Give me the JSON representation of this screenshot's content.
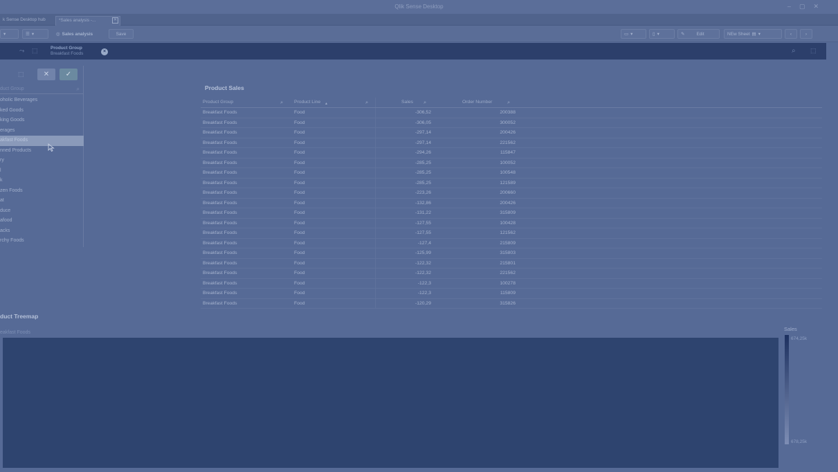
{
  "window": {
    "title": "Qlik Sense Desktop",
    "controls": [
      "–",
      "▢",
      "✕"
    ]
  },
  "tabs": [
    {
      "label": "k Sense Desktop hub",
      "active": false
    },
    {
      "label": "*Sales analysis -...",
      "active": true,
      "close": "✕"
    }
  ],
  "toolbar": {
    "app_name": "Sales analysis",
    "save_label": "Save",
    "edit_label": "Edit",
    "new_sheet_label": "NEw Sheet"
  },
  "selections": {
    "field": "Product Group",
    "value": "Breakfast Foods"
  },
  "listbox": {
    "search_placeholder": "duct Group",
    "items": [
      {
        "label": "ohoIic Beverages",
        "selected": false
      },
      {
        "label": "ked Goods",
        "selected": false
      },
      {
        "label": "king Goods",
        "selected": false
      },
      {
        "label": "erages",
        "selected": false
      },
      {
        "label": "akfast Foods",
        "selected": true
      },
      {
        "label": "nned Products",
        "selected": false
      },
      {
        "label": "ry",
        "selected": false
      },
      {
        "label": "l",
        "selected": false
      },
      {
        "label": "k",
        "selected": false
      },
      {
        "label": "zen Foods",
        "selected": false
      },
      {
        "label": "at",
        "selected": false
      },
      {
        "label": "duce",
        "selected": false
      },
      {
        "label": "afood",
        "selected": false
      },
      {
        "label": "acks",
        "selected": false
      },
      {
        "label": "rchy Foods",
        "selected": false
      }
    ]
  },
  "product_sales": {
    "title": "Product Sales",
    "columns": [
      "Product Group",
      "Product Line",
      "Sales",
      "Order Number"
    ],
    "rows": [
      [
        "Breakfast Foods",
        "Food",
        "-306,52",
        "200388"
      ],
      [
        "Breakfast Foods",
        "Food",
        "-306,05",
        "300052"
      ],
      [
        "Breakfast Foods",
        "Food",
        "-297,14",
        "200426"
      ],
      [
        "Breakfast Foods",
        "Food",
        "-297,14",
        "221562"
      ],
      [
        "Breakfast Foods",
        "Food",
        "-294,26",
        "115847"
      ],
      [
        "Breakfast Foods",
        "Food",
        "-285,25",
        "100052"
      ],
      [
        "Breakfast Foods",
        "Food",
        "-285,25",
        "100548"
      ],
      [
        "Breakfast Foods",
        "Food",
        "-285,25",
        "121589"
      ],
      [
        "Breakfast Foods",
        "Food",
        "-223,26",
        "200660"
      ],
      [
        "Breakfast Foods",
        "Food",
        "-132,86",
        "200426"
      ],
      [
        "Breakfast Foods",
        "Food",
        "-131,22",
        "315809"
      ],
      [
        "Breakfast Foods",
        "Food",
        "-127,55",
        "100428"
      ],
      [
        "Breakfast Foods",
        "Food",
        "-127,55",
        "121562"
      ],
      [
        "Breakfast Foods",
        "Food",
        "-127,4",
        "215809"
      ],
      [
        "Breakfast Foods",
        "Food",
        "-125,99",
        "315803"
      ],
      [
        "Breakfast Foods",
        "Food",
        "-122,32",
        "215801"
      ],
      [
        "Breakfast Foods",
        "Food",
        "-122,32",
        "221562"
      ],
      [
        "Breakfast Foods",
        "Food",
        "-122,3",
        "100278"
      ],
      [
        "Breakfast Foods",
        "Food",
        "-122,3",
        "115809"
      ],
      [
        "Breakfast Foods",
        "Food",
        "-120,29",
        "315826"
      ]
    ]
  },
  "treemap": {
    "title": "duct Treemap",
    "subtitle": "eakfast Foods",
    "legend_title": "Sales",
    "legend_max": "674,25k",
    "legend_min": "678,25k"
  }
}
